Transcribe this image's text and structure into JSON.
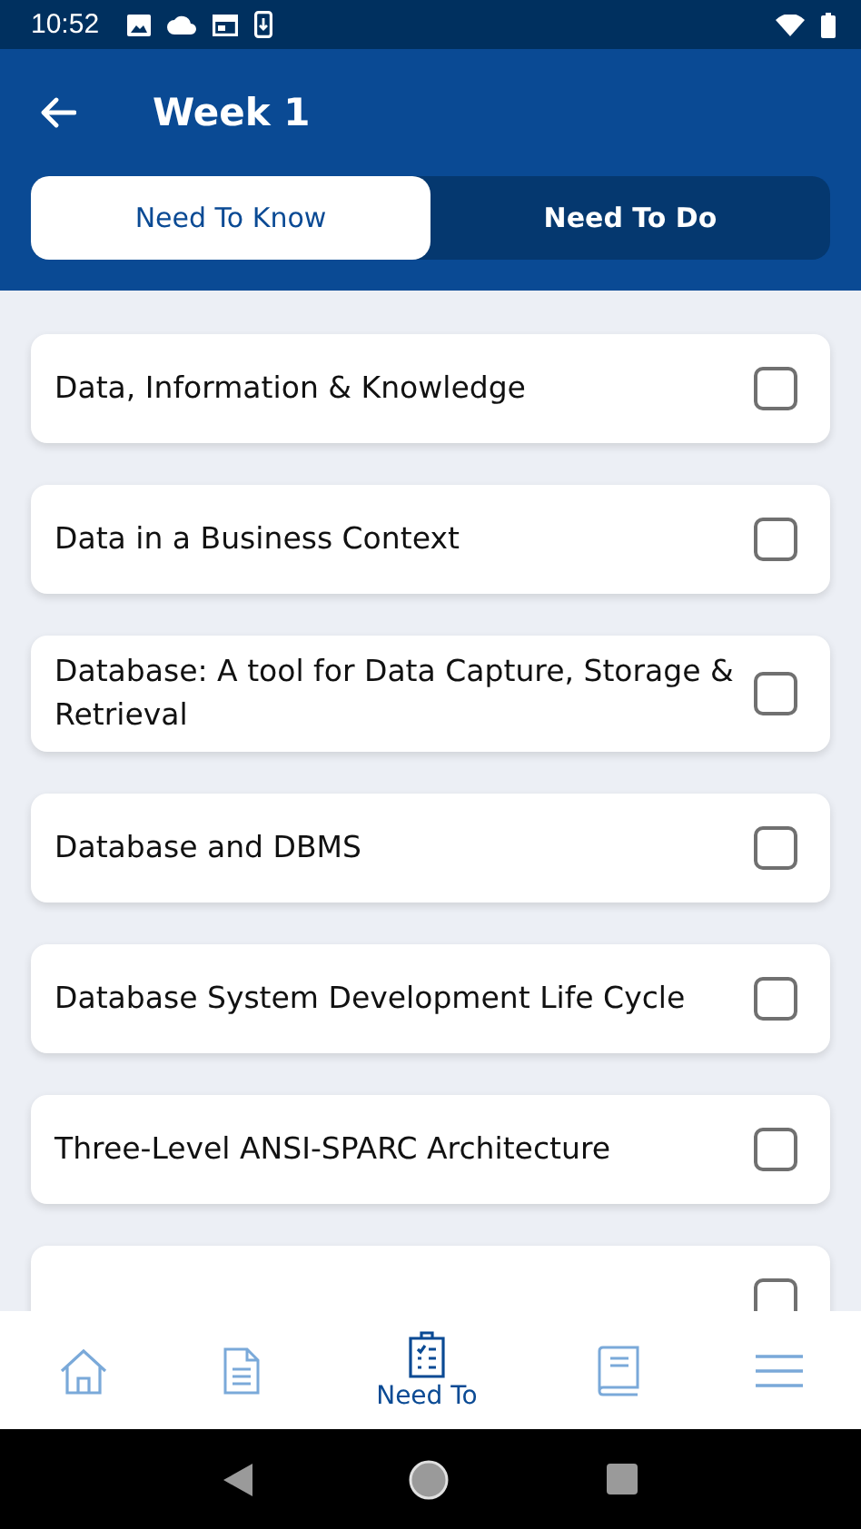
{
  "status_bar": {
    "time": "10:52"
  },
  "header": {
    "title": "Week 1"
  },
  "tabs": [
    {
      "label": "Need To Know",
      "selected": true
    },
    {
      "label": "Need To Do",
      "selected": false
    }
  ],
  "topics": [
    {
      "title": "Data, Information & Knowledge",
      "checked": false
    },
    {
      "title": "Data in a Business Context",
      "checked": false
    },
    {
      "title": "Database: A tool for Data Capture, Storage & Retrieval",
      "checked": false
    },
    {
      "title": "Database and DBMS",
      "checked": false
    },
    {
      "title": "Database System Development Life Cycle",
      "checked": false
    },
    {
      "title": "Three-Level ANSI-SPARC Architecture",
      "checked": false
    },
    {
      "checked": false
    }
  ],
  "bottom_nav": [
    {
      "kind": "home",
      "selected": false
    },
    {
      "kind": "document",
      "selected": false
    },
    {
      "kind": "checklist",
      "label": "Need To",
      "selected": true
    },
    {
      "kind": "book",
      "selected": false
    },
    {
      "kind": "menu",
      "selected": false
    }
  ]
}
